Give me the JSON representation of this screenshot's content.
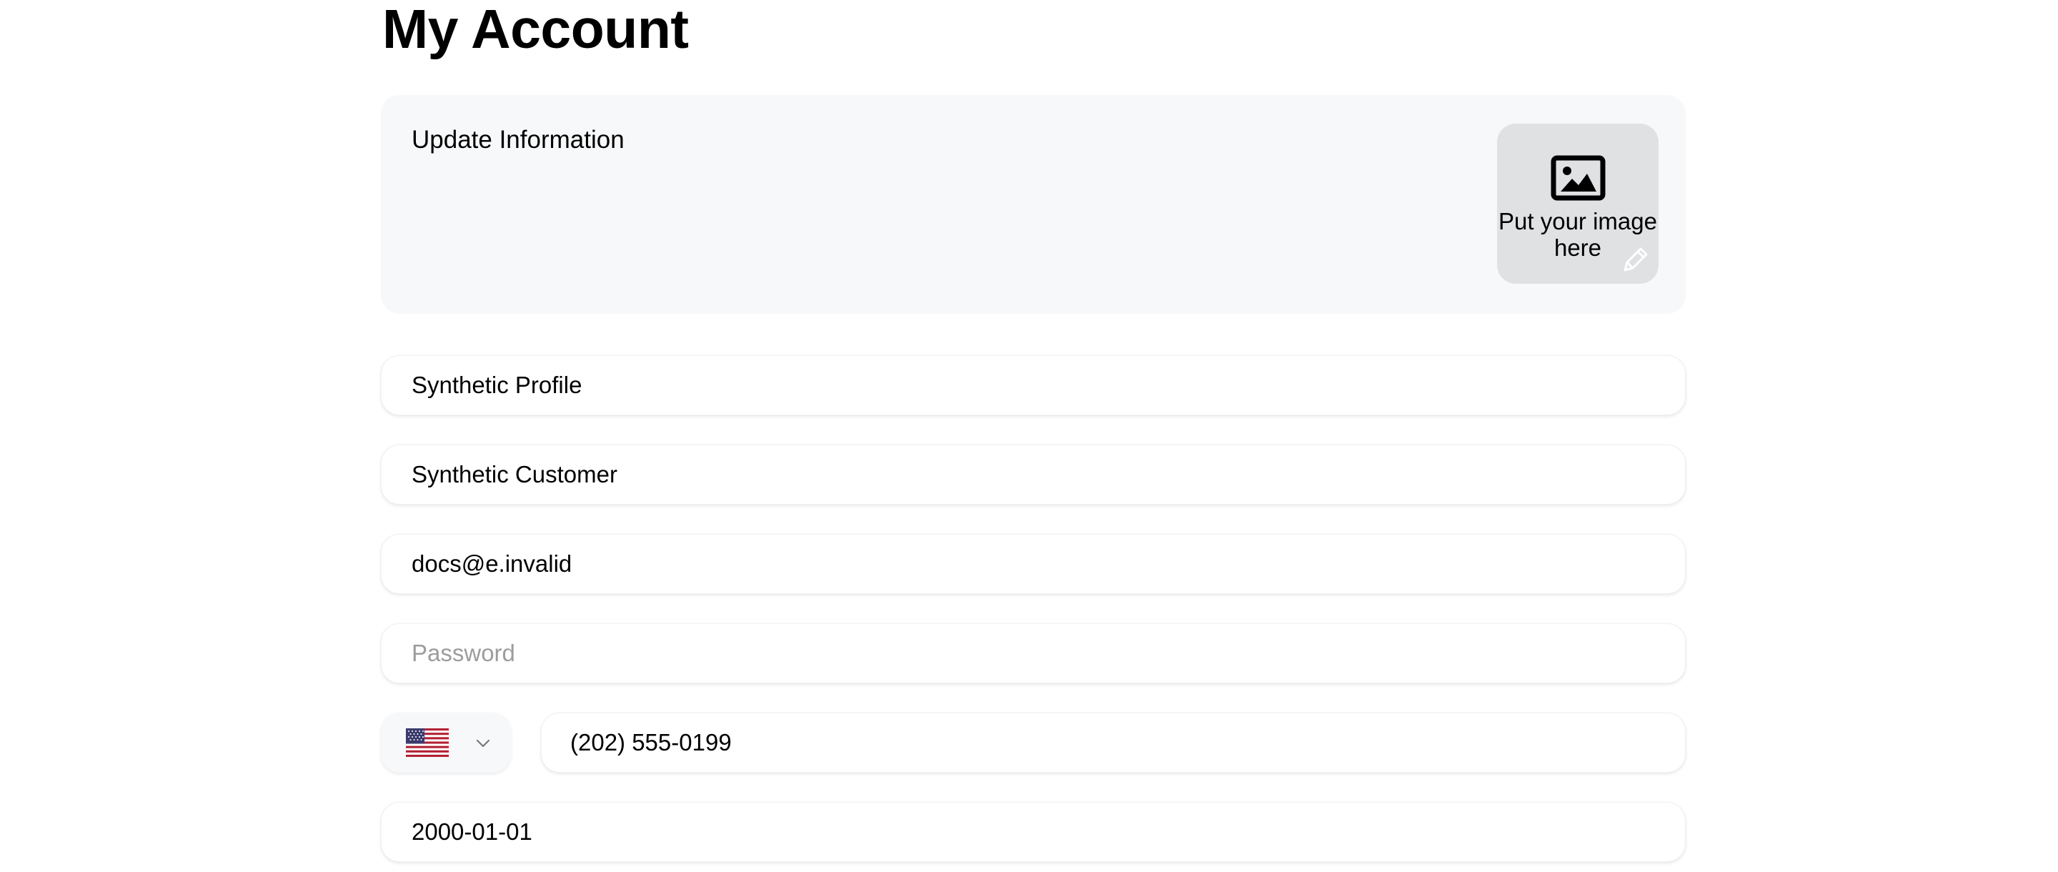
{
  "page": {
    "title": "My Account"
  },
  "info_card": {
    "title": "Update Information",
    "image_upload": {
      "text": "Put your image here",
      "icon": "image-icon",
      "edit_icon": "pencil-icon"
    }
  },
  "form": {
    "first_name": {
      "value": "Synthetic Profile",
      "placeholder": ""
    },
    "last_name": {
      "value": "Synthetic Customer",
      "placeholder": ""
    },
    "email": {
      "value": "docs@e.invalid",
      "placeholder": ""
    },
    "password": {
      "value": "",
      "placeholder": "Password"
    },
    "phone": {
      "country_flag": "us-flag-icon",
      "value": "(202) 555-0199",
      "placeholder": ""
    },
    "birthdate": {
      "value": "2000-01-01",
      "placeholder": ""
    }
  },
  "colors": {
    "card_background": "#f7f8f9",
    "image_box_background": "#e0e1e3",
    "placeholder_text": "#9c9c9c"
  }
}
